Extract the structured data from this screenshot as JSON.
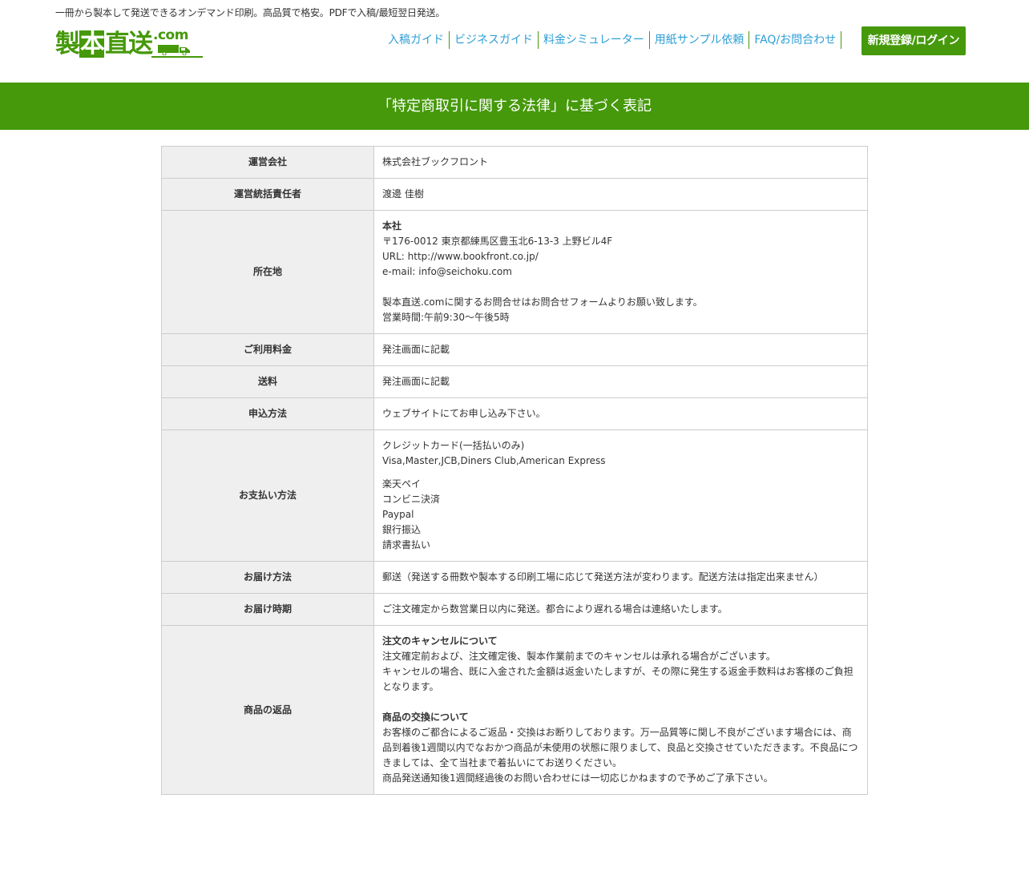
{
  "header": {
    "tagline": "一冊から製本して発送できるオンデマンド印刷。高品質で格安。PDFで入稿/最短翌日発送。",
    "logo": {
      "chars": [
        "製",
        "本",
        "直",
        "送"
      ],
      "suffix": ".com"
    },
    "nav": [
      {
        "label": "入稿ガイド"
      },
      {
        "label": "ビジネスガイド"
      },
      {
        "label": "料金シミュレーター"
      },
      {
        "label": "用紙サンプル依頼"
      },
      {
        "label": "FAQ/お問合わせ"
      }
    ],
    "login_button": "新規登録/ログイン"
  },
  "banner": {
    "title": "「特定商取引に関する法律」に基づく表記"
  },
  "table": {
    "rows": [
      {
        "label": "運営会社",
        "lines": [
          "株式会社ブックフロント"
        ]
      },
      {
        "label": "運営統括責任者",
        "lines": [
          "渡邊 佳樹"
        ]
      },
      {
        "label": "所在地",
        "heading": "本社",
        "lines": [
          "〒176-0012 東京都練馬区豊玉北6-13-3 上野ビル4F",
          "URL: http://www.bookfront.co.jp/",
          "e-mail: info@seichoku.com"
        ],
        "lines2": [
          "製本直送.comに関するお問合せはお問合せフォームよりお願い致します。",
          "営業時間:午前9:30～午後5時"
        ]
      },
      {
        "label": "ご利用料金",
        "lines": [
          "発注画面に記載"
        ]
      },
      {
        "label": "送料",
        "lines": [
          "発注画面に記載"
        ]
      },
      {
        "label": "申込方法",
        "lines": [
          "ウェブサイトにてお申し込み下さい。"
        ]
      },
      {
        "label": "お支払い方法",
        "lines": [
          "クレジットカード(一括払いのみ)",
          "Visa,Master,JCB,Diners Club,American Express"
        ],
        "lines2": [
          "楽天ペイ",
          "コンビニ決済",
          "Paypal",
          "銀行振込",
          "請求書払い"
        ]
      },
      {
        "label": "お届け方法",
        "lines": [
          "郵送（発送する冊数や製本する印刷工場に応じて発送方法が変わります。配送方法は指定出来ません）"
        ]
      },
      {
        "label": "お届け時期",
        "lines": [
          "ご注文確定から数営業日以内に発送。都合により遅れる場合は連絡いたします。"
        ]
      },
      {
        "label": "商品の返品",
        "heading": "注文のキャンセルについて",
        "lines": [
          "注文確定前および、注文確定後、製本作業前までのキャンセルは承れる場合がございます。",
          "キャンセルの場合、既に入金された金額は返金いたしますが、その際に発生する返金手数料はお客様のご負担となります。"
        ],
        "heading2": "商品の交換について",
        "lines2": [
          "お客様のご都合によるご返品・交換はお断りしております。万一品質等に関し不良がございます場合には、商品到着後1週間以内でなおかつ商品が未使用の状態に限りまして、良品と交換させていただきます。不良品につきましては、全て当社まで着払いにてお送りください。",
          "商品発送通知後1週間経過後のお問い合わせには一切応じかねますので予めご了承下さい。"
        ]
      }
    ]
  },
  "colors": {
    "brand_green": "#45990a",
    "link_blue": "#2e9fd6",
    "header_cell_bg": "#efefef"
  }
}
